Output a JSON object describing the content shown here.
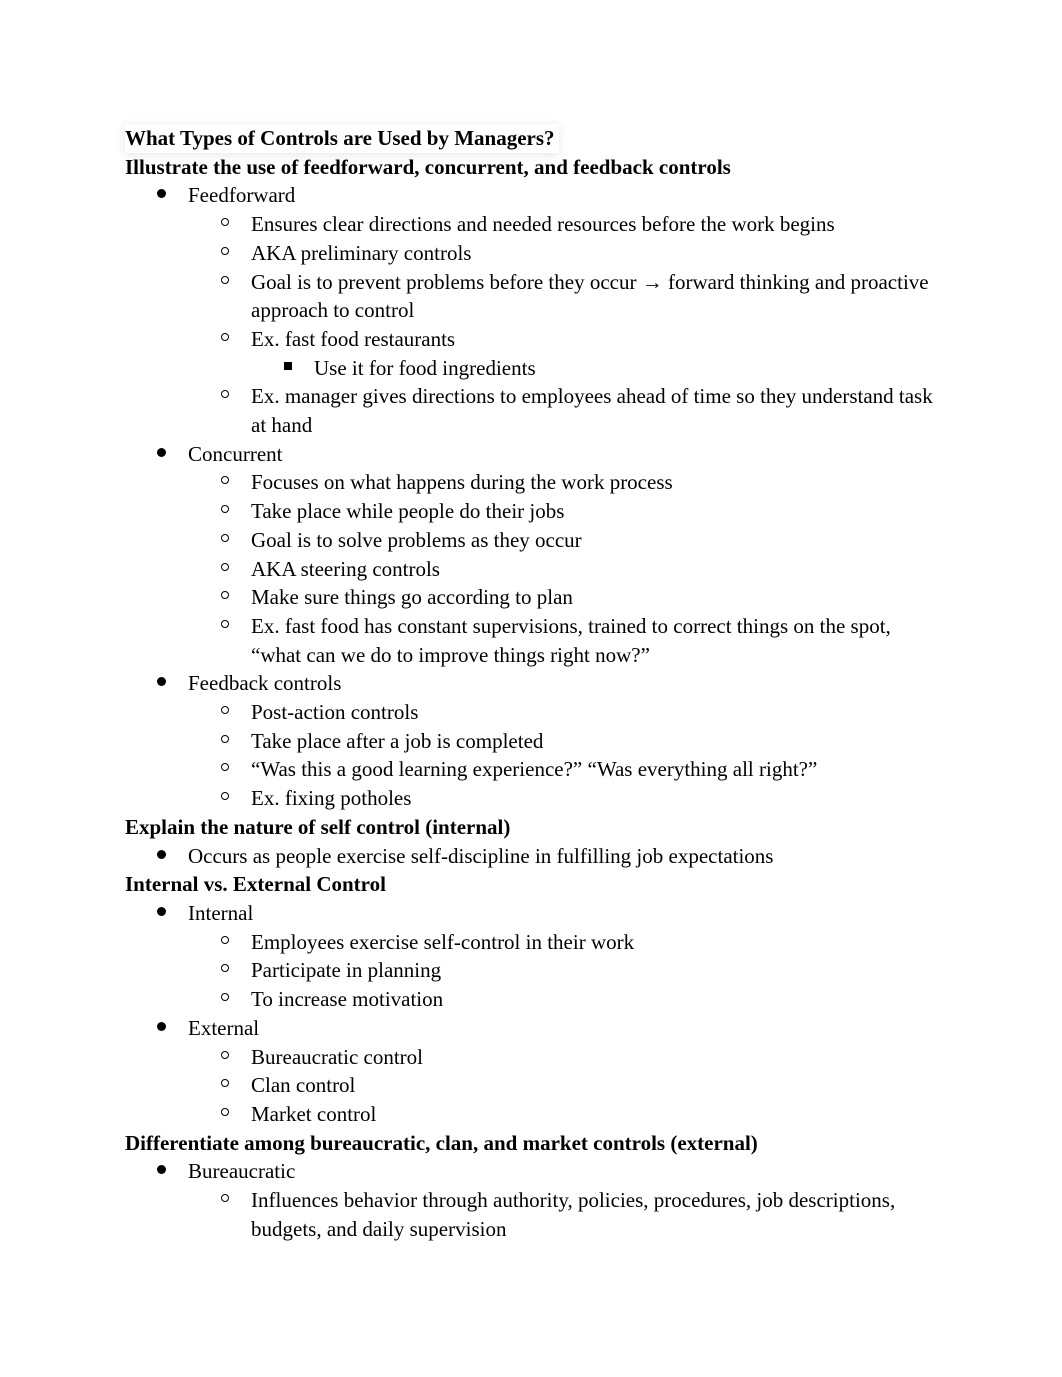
{
  "document": {
    "sections": [
      {
        "heading": "What Types of Controls are Used by Managers?",
        "items": []
      },
      {
        "heading": "Illustrate the use of feedforward, concurrent, and feedback controls",
        "items": [
          {
            "text": "Feedforward",
            "children": [
              {
                "text": "Ensures clear directions and needed resources before the work begins"
              },
              {
                "text": "AKA preliminary controls"
              },
              {
                "text": "Goal is to prevent problems before they occur → forward thinking and proactive approach to control"
              },
              {
                "text": "Ex. fast food restaurants",
                "children": [
                  {
                    "text": "Use it for food ingredients"
                  }
                ]
              },
              {
                "text": "Ex. manager gives directions to employees ahead of time so they understand task at hand"
              }
            ]
          },
          {
            "text": "Concurrent",
            "children": [
              {
                "text": "Focuses on what happens during the work process"
              },
              {
                "text": "Take place while people do their jobs"
              },
              {
                "text": "Goal is to solve problems as they occur"
              },
              {
                "text": "AKA steering controls"
              },
              {
                "text": "Make sure things go according to plan"
              },
              {
                "text": "Ex. fast food has constant supervisions, trained to correct things on the spot, “what can we do to improve things right now?”"
              }
            ]
          },
          {
            "text": "Feedback controls",
            "children": [
              {
                "text": "Post-action controls"
              },
              {
                "text": "Take place after a job is completed"
              },
              {
                "text": "“Was this a good learning experience?” “Was everything all right?”"
              },
              {
                "text": "Ex. fixing potholes"
              }
            ]
          }
        ]
      },
      {
        "heading": "Explain the nature of self control (internal)",
        "items": [
          {
            "text": "Occurs as people exercise self-discipline in fulfilling job expectations"
          }
        ]
      },
      {
        "heading": "Internal vs. External Control",
        "items": [
          {
            "text": "Internal",
            "children": [
              {
                "text": "Employees exercise self-control in their work"
              },
              {
                "text": "Participate in planning"
              },
              {
                "text": "To increase motivation"
              }
            ]
          },
          {
            "text": "External",
            "children": [
              {
                "text": "Bureaucratic control"
              },
              {
                "text": "Clan control"
              },
              {
                "text": "Market control"
              }
            ]
          }
        ]
      },
      {
        "heading": "Differentiate among bureaucratic, clan, and market controls (external)",
        "items": [
          {
            "text": "Bureaucratic",
            "children": [
              {
                "text": "Influences behavior through authority, policies, procedures, job descriptions, budgets, and daily supervision"
              }
            ]
          }
        ]
      }
    ]
  }
}
